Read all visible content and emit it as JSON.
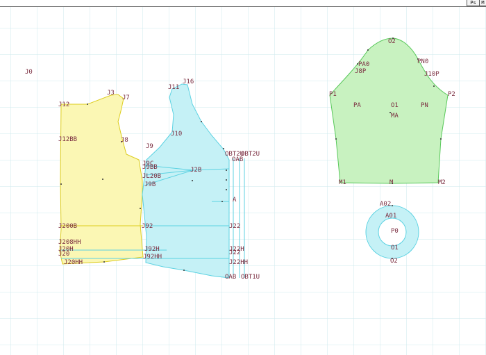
{
  "toolbar": {
    "ps_label": "Ps",
    "m_label": "M"
  },
  "colors": {
    "grid": "#cde9ee",
    "yellow_piece": "#fbf7b4",
    "yellow_stroke": "#dccc1c",
    "cyan_piece": "#c5f1f6",
    "cyan_stroke": "#5cd2e2",
    "green_piece": "#c8f2c0",
    "green_stroke": "#58c85a",
    "label": "#7a2c3f"
  },
  "labels": {
    "j0": "J0",
    "j3": "J3",
    "j7": "J7",
    "j12": "J12",
    "j8": "J8",
    "j12bb": "J12BB",
    "j200b": "J200B",
    "j208hh": "J208HH",
    "j20h": "J20H",
    "j20": "J20",
    "j20hh": "J20HH",
    "j16": "J16",
    "j11": "J11",
    "j10": "J10",
    "j9": "J9",
    "j9c": "J9C",
    "j9bb": "J9BB",
    "jl20b": "JL20B",
    "j9b": "J9B",
    "j2b": "J2B",
    "a": "A",
    "j92": "J92",
    "j22": "J22",
    "j92h": "J92H",
    "j92hh": "J92HH",
    "j22h": "J22H",
    "j22_lower": "J22",
    "j22hh": "J22HH",
    "obt2u": "OBT2U",
    "obt2u_b": "OBT2U",
    "oab": "OAB",
    "oab_low": "OAB",
    "obt1u": "OBT1U",
    "o2": "O2",
    "p1": "P1",
    "p2": "P2",
    "pa0": "PA0",
    "j8p": "J8P",
    "pn0": "PN0",
    "j10p": "J10P",
    "pa": "PA",
    "o1": "O1",
    "pn": "PN",
    "ma": "MA",
    "m1": "M1",
    "m": "M",
    "m2": "M2",
    "a02": "A02",
    "a01": "A01",
    "p0": "P0",
    "ring_o1": "O1",
    "ring_o2": "O2"
  }
}
